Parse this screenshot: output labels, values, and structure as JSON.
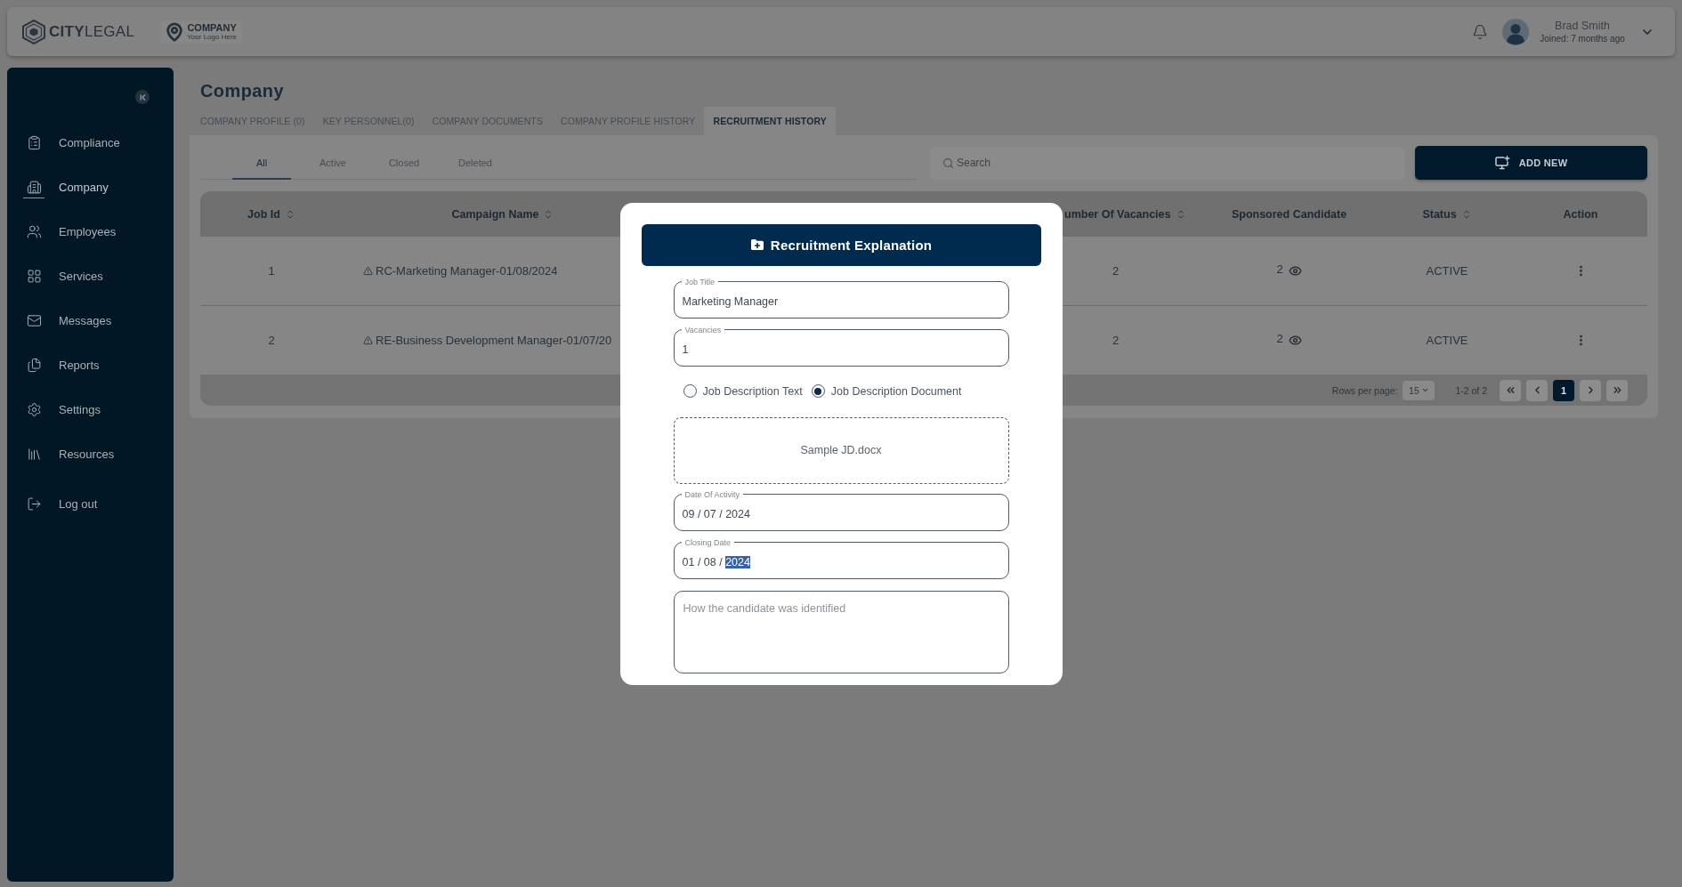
{
  "header": {
    "brand": "**CITY**LEGAL",
    "company_logo": {
      "name": "COMPANY",
      "tagline": "Your Logo Here"
    },
    "user": {
      "name": "Brad Smith",
      "subtitle": "Joined: 7 months ago"
    }
  },
  "sidebar": {
    "items": [
      {
        "label": "Compliance",
        "selected": false
      },
      {
        "label": "Company",
        "selected": true
      },
      {
        "label": "Employees",
        "selected": false
      },
      {
        "label": "Services",
        "selected": false
      },
      {
        "label": "Messages",
        "selected": false
      },
      {
        "label": "Reports",
        "selected": false
      },
      {
        "label": "Settings",
        "selected": false
      },
      {
        "label": "Resources",
        "selected": false
      },
      {
        "label": "Log out",
        "selected": false
      }
    ]
  },
  "page": {
    "title": "Company",
    "tabs": [
      {
        "label": "COMPANY PROFILE (0)",
        "selected": false
      },
      {
        "label": "KEY PERSONNEL(0)",
        "selected": false
      },
      {
        "label": "COMPANY DOCUMENTS",
        "selected": false
      },
      {
        "label": "COMPANY PROFILE HISTORY",
        "selected": false
      },
      {
        "label": "RECRUITMENT HISTORY",
        "selected": true
      }
    ],
    "filters": [
      {
        "label": "All",
        "selected": true
      },
      {
        "label": "Active",
        "selected": false
      },
      {
        "label": "Closed",
        "selected": false
      },
      {
        "label": "Deleted",
        "selected": false
      }
    ],
    "search": {
      "placeholder": "Search"
    },
    "add_button": "ADD NEW"
  },
  "table": {
    "columns": [
      {
        "label": "Job Id",
        "sortable": true
      },
      {
        "label": "Campaign Name",
        "sortable": true
      },
      {
        "label": "umber Of Vacancies",
        "sortable": true
      },
      {
        "label": "Sponsored Candidate",
        "sortable": false
      },
      {
        "label": "Status",
        "sortable": true
      },
      {
        "label": "Action",
        "sortable": false
      }
    ],
    "rows": [
      {
        "job_id": "1",
        "warning": true,
        "campaign": "RC-Marketing Manager-01/08/2024",
        "vacancies": "2",
        "sponsored": "2",
        "status": "ACTIVE"
      },
      {
        "job_id": "2",
        "warning": true,
        "campaign": "RE-Business Development Manager-01/07/20",
        "vacancies": "2",
        "sponsored": "2",
        "status": "ACTIVE"
      }
    ],
    "footer": {
      "rows_per_page_label": "Rows per page:",
      "rows_per_page": "15",
      "range": "1-2 of 2",
      "pages": [
        {
          "label": "1",
          "selected": true
        }
      ]
    }
  },
  "modal": {
    "title": "Recruitment Explanation",
    "job_title": {
      "label": "Job Title",
      "value": "Marketing Manager"
    },
    "vacancies": {
      "label": "Vacancies",
      "value": "1"
    },
    "description_options": [
      {
        "label": "Job Description Text",
        "selected": false
      },
      {
        "label": "Job Description Document",
        "selected": true
      }
    ],
    "upload": {
      "file_name": "Sample JD.docx"
    },
    "date_of_activity": {
      "label": "Date Of Activity",
      "segments": [
        {
          "text": "09 / 07 / 2024",
          "selected": false
        }
      ]
    },
    "closing_date": {
      "label": "Closing Date",
      "segments": [
        {
          "text": "01 / 08 / ",
          "selected": false
        },
        {
          "text": "2024",
          "selected": true
        }
      ]
    },
    "notes": {
      "placeholder": "How the candidate was identified"
    }
  }
}
